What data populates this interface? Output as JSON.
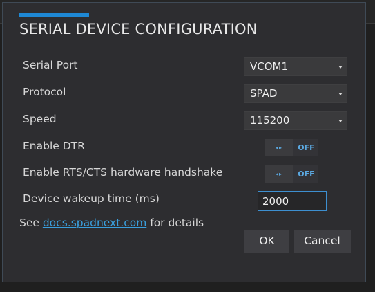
{
  "dialog": {
    "title": "SERIAL DEVICE CONFIGURATION",
    "accent_color": "#1e88d4"
  },
  "fields": {
    "serial_port": {
      "label": "Serial Port",
      "value": "VCOM1"
    },
    "protocol": {
      "label": "Protocol",
      "value": "SPAD"
    },
    "speed": {
      "label": "Speed",
      "value": "115200"
    },
    "enable_dtr": {
      "label": "Enable DTR",
      "arrows": "◂▸",
      "state": "OFF"
    },
    "enable_rts_cts": {
      "label": "Enable RTS/CTS hardware handshake",
      "arrows": "◂▸",
      "state": "OFF"
    },
    "wakeup_time": {
      "label": "Device wakeup time (ms)",
      "value": "2000"
    }
  },
  "note": {
    "prefix": "See ",
    "link": "docs.spadnext.com",
    "suffix": " for details"
  },
  "buttons": {
    "ok": "OK",
    "cancel": "Cancel"
  },
  "icons": {
    "dropdown": "chevron-down-icon",
    "toggle": "left-right-arrows-icon"
  }
}
